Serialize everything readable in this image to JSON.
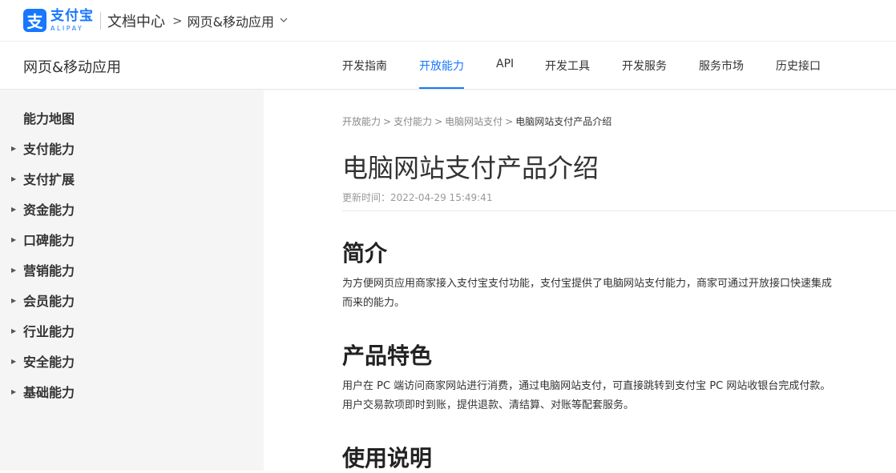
{
  "header": {
    "logo_glyph": "支",
    "logo_cn": "支付宝",
    "logo_en": "ALIPAY",
    "doc_center": "文档中心",
    "crumb_sep": ">",
    "product": "网页&移动应用"
  },
  "subnav": {
    "title": "网页&移动应用",
    "tabs": [
      {
        "label": "开发指南"
      },
      {
        "label": "开放能力",
        "active": true
      },
      {
        "label": "API"
      },
      {
        "label": "开发工具"
      },
      {
        "label": "开发服务"
      },
      {
        "label": "服务市场"
      },
      {
        "label": "历史接口"
      }
    ]
  },
  "sidebar": {
    "items": [
      {
        "label": "能力地图",
        "expandable": false
      },
      {
        "label": "支付能力",
        "expandable": true
      },
      {
        "label": "支付扩展",
        "expandable": true
      },
      {
        "label": "资金能力",
        "expandable": true
      },
      {
        "label": "口碑能力",
        "expandable": true
      },
      {
        "label": "营销能力",
        "expandable": true
      },
      {
        "label": "会员能力",
        "expandable": true
      },
      {
        "label": "行业能力",
        "expandable": true
      },
      {
        "label": "安全能力",
        "expandable": true
      },
      {
        "label": "基础能力",
        "expandable": true
      }
    ]
  },
  "main": {
    "breadcrumb": [
      "开放能力",
      "支付能力",
      "电脑网站支付",
      "电脑网站支付产品介绍"
    ],
    "breadcrumb_sep": ">",
    "title": "电脑网站支付产品介绍",
    "update_time": "更新时间：2022-04-29 15:49:41",
    "sections": [
      {
        "heading": "简介",
        "lines": [
          "为方便网页应用商家接入支付宝支付功能，支付宝提供了电脑网站支付能力，商家可通过开放接口快速集成",
          "而来的能力。"
        ]
      },
      {
        "heading": "产品特色",
        "lines": [
          "用户在 PC 端访问商家网站进行消费，通过电脑网站支付，可直接跳转到支付宝 PC 网站收银台完成付款。",
          "用户交易款项即时到账，提供退款、清结算、对账等配套服务。"
        ]
      },
      {
        "heading": "使用说明",
        "lines": []
      }
    ]
  },
  "colors": {
    "accent": "#1677ff",
    "sidebar_bg": "#f5f5f5"
  }
}
